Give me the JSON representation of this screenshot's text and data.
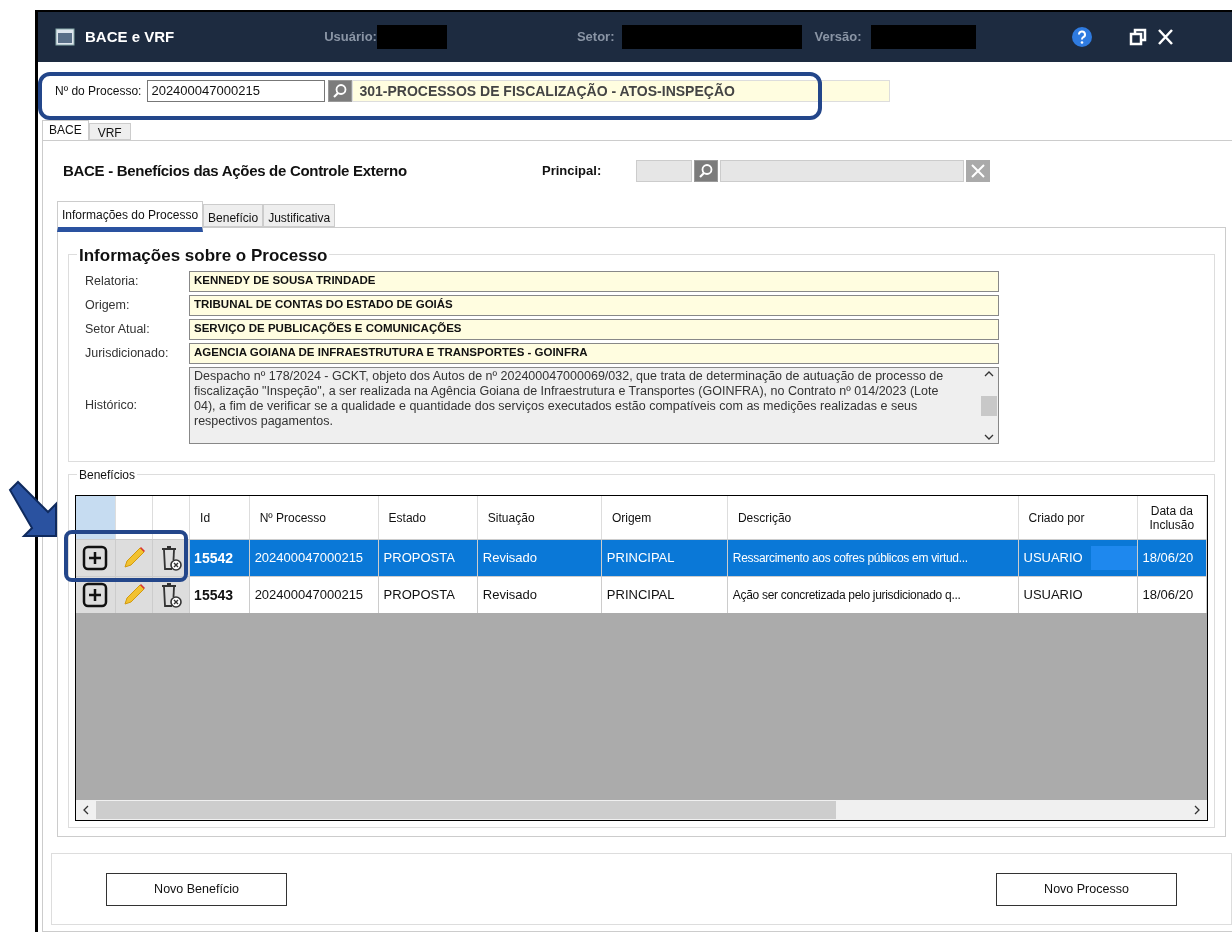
{
  "window": {
    "title": "BACE e VRF",
    "user_label": "Usuário:",
    "sector_label": "Setor:",
    "version_label": "Versão:"
  },
  "process": {
    "label": "Nº do Processo:",
    "value": "202400047000215",
    "description": "301-PROCESSOS DE FISCALIZAÇÃO - ATOS-INSPEÇÃO"
  },
  "top_tabs": [
    {
      "label": "BACE",
      "selected": true
    },
    {
      "label": "VRF",
      "selected": false
    }
  ],
  "section_title": "BACE - Benefícios das Ações de Controle Externo",
  "principal": {
    "label": "Principal:"
  },
  "inner_tabs": [
    {
      "label": "Informações do Processo",
      "selected": true
    },
    {
      "label": "Benefício",
      "selected": false
    },
    {
      "label": "Justificativa",
      "selected": false
    }
  ],
  "info": {
    "title": "Informações sobre o Processo",
    "fields": [
      {
        "label": "Relatoria:",
        "value": "KENNEDY DE SOUSA TRINDADE"
      },
      {
        "label": "Origem:",
        "value": "TRIBUNAL DE CONTAS DO ESTADO DE GOIÁS"
      },
      {
        "label": "Setor Atual:",
        "value": "SERVIÇO DE PUBLICAÇÕES E COMUNICAÇÕES"
      },
      {
        "label": "Jurisdicionado:",
        "value": "AGENCIA GOIANA DE INFRAESTRUTURA E TRANSPORTES - GOINFRA"
      }
    ],
    "history_label": "Histórico:",
    "history": "Despacho nº 178/2024 - GCKT, objeto dos Autos de nº 202400047000069/032, que trata de determinação de autuação de processo de fiscalização \"Inspeção\", a ser realizada na Agência Goiana de Infraestrutura e Transportes (GOINFRA), no Contrato nº 014/2023 (Lote 04), a fim de verificar se a qualidade e quantidade dos serviços executados estão compatíveis com as medições realizadas e seus respectivos pagamentos."
  },
  "benefits": {
    "title": "Benefícios",
    "columns": [
      "Id",
      "Nº Processo",
      "Estado",
      "Situação",
      "Origem",
      "Descrição",
      "Criado por",
      "Data da Inclusão"
    ],
    "rows": [
      {
        "selected": true,
        "cells": [
          "15542",
          "202400047000215",
          "PROPOSTA",
          "Revisado",
          "PRINCIPAL",
          "Ressarcimento aos cofres públicos em virtud...",
          "USUARIO",
          "18/06/20"
        ]
      },
      {
        "selected": false,
        "cells": [
          "15543",
          "202400047000215",
          "PROPOSTA",
          "Revisado",
          "PRINCIPAL",
          "Ação  ser concretizada pelo jurisdicionado q...",
          "USUARIO",
          "18/06/20"
        ]
      }
    ]
  },
  "buttons": [
    "Novo Benefício",
    "Novo Processo"
  ]
}
